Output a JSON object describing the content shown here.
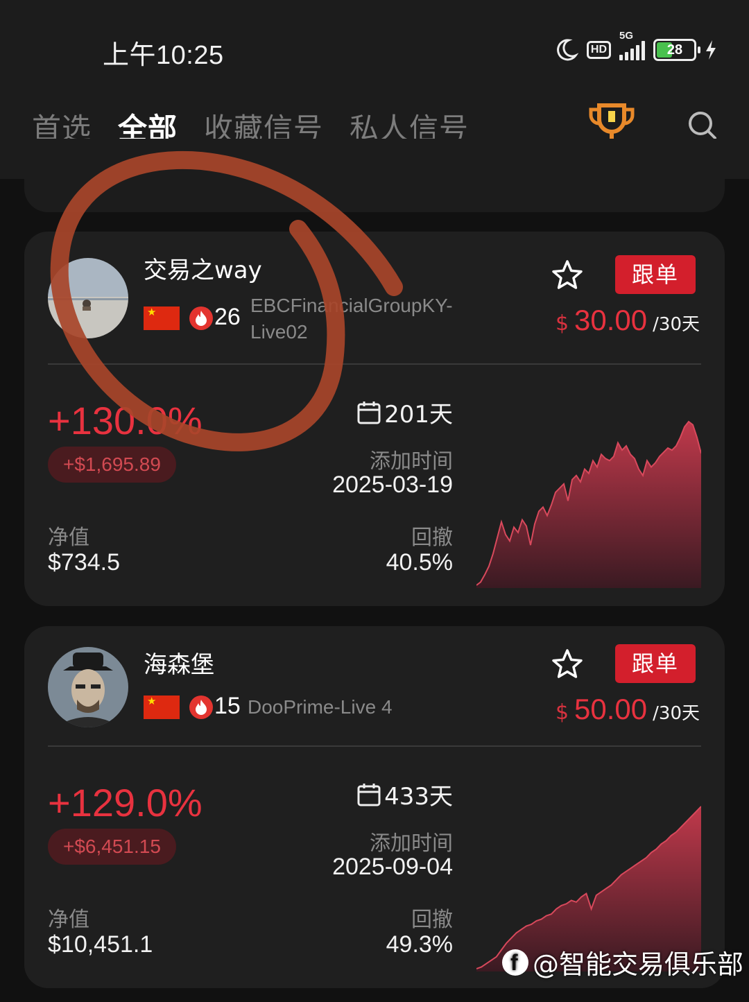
{
  "status": {
    "time": "上午10:25",
    "network": "5G",
    "hd": "HD",
    "battery": "28"
  },
  "nav": {
    "tabs": [
      {
        "label": "首选",
        "active": false
      },
      {
        "label": "全部",
        "active": true
      },
      {
        "label": "收藏信号",
        "active": false
      },
      {
        "label": "私人信号",
        "active": false
      }
    ],
    "icons": [
      "trophy-icon",
      "search-icon"
    ]
  },
  "signals": [
    {
      "name": "交易之way",
      "country": "CN",
      "heat": "26",
      "server_line1": "EBCFinancialGroupKY-",
      "server_line2": "Live02",
      "follow": "跟单",
      "price_currency": "$",
      "price": "30.00",
      "period": "/30天",
      "return": "+130.0%",
      "pnl": "+$1,695.89",
      "days": "201天",
      "added_label": "添加时间",
      "added_date": "2025-03-19",
      "equity_label": "净值",
      "equity": "$734.5",
      "drawdown_label": "回撤",
      "drawdown": "40.5%",
      "chart_data": {
        "type": "area",
        "values": [
          0,
          3,
          10,
          18,
          30,
          45,
          60,
          48,
          42,
          55,
          50,
          62,
          56,
          38,
          58,
          70,
          74,
          66,
          76,
          88,
          92,
          96,
          80,
          100,
          104,
          98,
          110,
          106,
          118,
          112,
          124,
          120,
          118,
          122,
          135,
          128,
          132,
          124,
          120,
          110,
          104,
          118,
          112,
          116,
          122,
          126,
          130,
          128,
          132,
          140,
          150,
          155,
          152,
          140,
          125
        ],
        "color": "#c0394b"
      }
    },
    {
      "name": "海森堡",
      "country": "CN",
      "heat": "15",
      "server_line1": "DooPrime-Live 4",
      "follow": "跟单",
      "price_currency": "$",
      "price": "50.00",
      "period": "/30天",
      "return": "+129.0%",
      "pnl": "+$6,451.15",
      "days": "433天",
      "added_label": "添加时间",
      "added_date": "2025-09-04",
      "equity_label": "净值",
      "equity": "$10,451.1",
      "drawdown_label": "回撤",
      "drawdown": "49.3%",
      "chart_data": {
        "type": "area",
        "values": [
          0,
          2,
          6,
          10,
          14,
          22,
          30,
          36,
          42,
          46,
          50,
          52,
          56,
          58,
          62,
          64,
          70,
          74,
          76,
          80,
          78,
          84,
          88,
          70,
          86,
          90,
          94,
          98,
          104,
          110,
          114,
          118,
          122,
          126,
          130,
          136,
          140,
          146,
          150,
          156,
          160,
          166,
          172,
          178,
          184,
          190
        ],
        "color": "#c0394b"
      }
    }
  ],
  "watermark": "@智能交易俱乐部"
}
